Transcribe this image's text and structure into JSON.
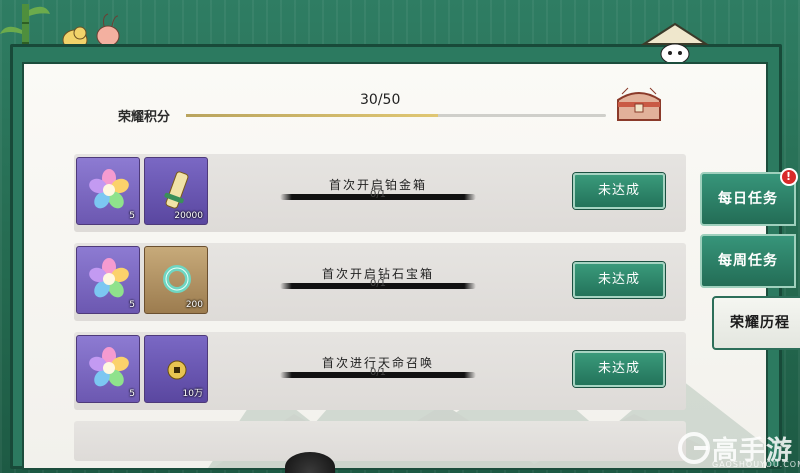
{
  "score": {
    "label": "荣耀积分",
    "value_text": "30/50",
    "progress": 0.6
  },
  "tasks": [
    {
      "name": "首次开启铂金箱",
      "progress": "0/1",
      "status": "未达成",
      "rewards": [
        {
          "icon": "rainbow-flower-icon",
          "count": "5"
        },
        {
          "icon": "scroll-icon",
          "count": "20000"
        }
      ]
    },
    {
      "name": "首次开启钻石宝箱",
      "progress": "0/1",
      "status": "未达成",
      "rewards": [
        {
          "icon": "rainbow-flower-icon",
          "count": "5"
        },
        {
          "icon": "jade-ring-icon",
          "count": "200"
        }
      ]
    },
    {
      "name": "首次进行天命召唤",
      "progress": "0/1",
      "status": "未达成",
      "rewards": [
        {
          "icon": "rainbow-flower-icon",
          "count": "5"
        },
        {
          "icon": "coin-icon",
          "count": "10万"
        }
      ]
    }
  ],
  "tabs": [
    {
      "label": "每日任务",
      "badge": "!"
    },
    {
      "label": "每周任务"
    },
    {
      "label": "荣耀历程",
      "active": true
    }
  ],
  "watermark": {
    "title": "高手游",
    "subtitle": "GAOSHOUYOU.COM"
  },
  "colors": {
    "jade": "#2c7a60",
    "button": "#2a8066",
    "badge": "#d92a2a"
  }
}
